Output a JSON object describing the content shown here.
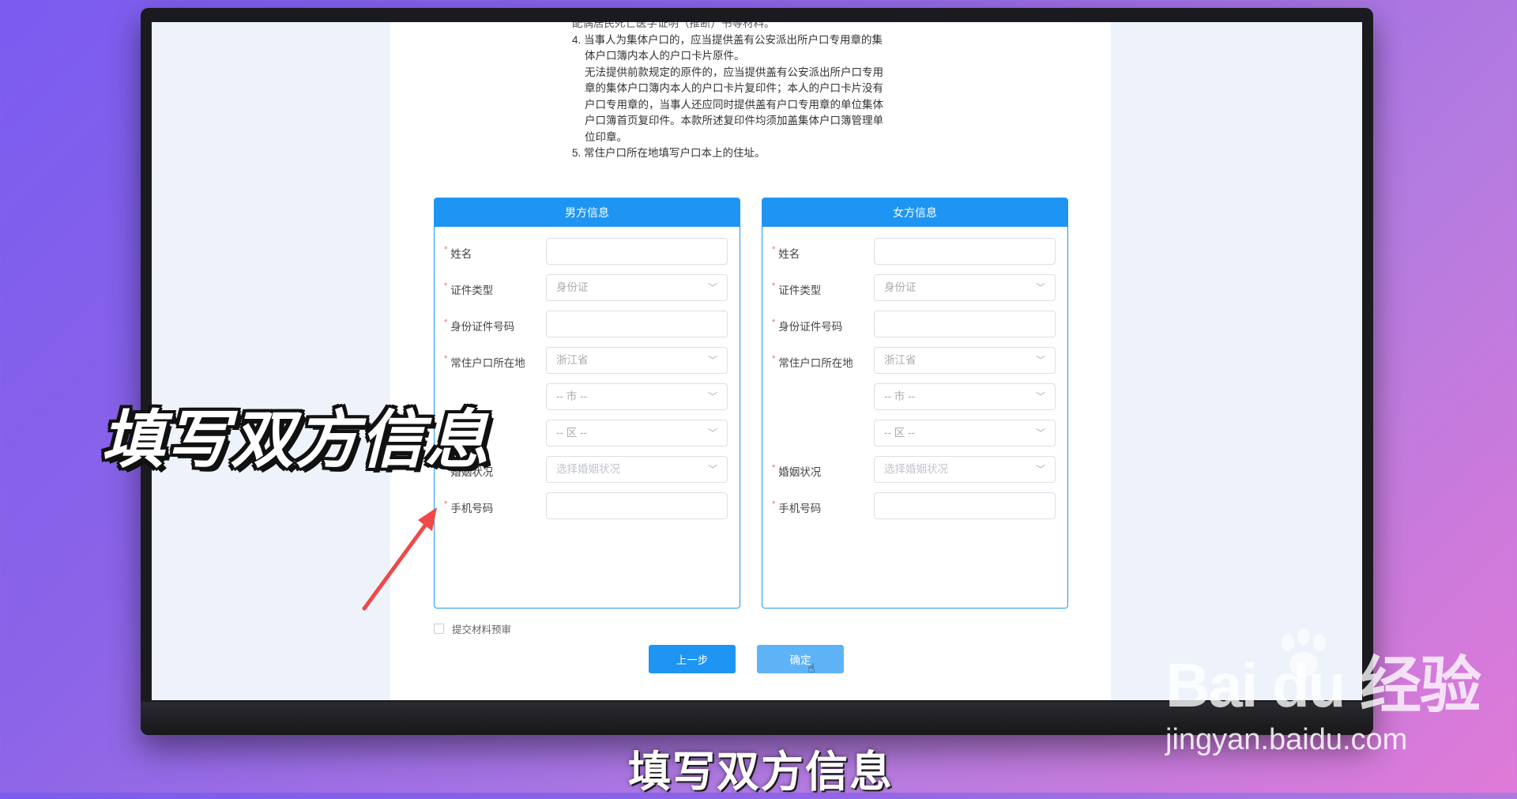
{
  "notes": {
    "line0": "配偶居民死亡医学证明（推断）书等材料。",
    "item4_a": "4. 当事人为集体户口的，应当提供盖有公安派出所户口专用章的集",
    "item4_b": "体户口簿内本人的户口卡片原件。",
    "item4_c": "无法提供前款规定的原件的，应当提供盖有公安派出所户口专用",
    "item4_d": "章的集体户口簿内本人的户口卡片复印件；本人的户口卡片没有",
    "item4_e": "户口专用章的，当事人还应同时提供盖有户口专用章的单位集体",
    "item4_f": "户口簿首页复印件。本款所述复印件均须加盖集体户口簿管理单",
    "item4_g": "位印章。",
    "item5": "5. 常住户口所在地填写户口本上的住址。"
  },
  "male": {
    "header": "男方信息",
    "name_label": "姓名",
    "idtype_label": "证件类型",
    "idtype_value": "身份证",
    "idno_label": "身份证件号码",
    "residence_label": "常住户口所在地",
    "province_value": "浙江省",
    "city_value": "-- 市 --",
    "district_value": "-- 区 --",
    "marital_label": "婚姻状况",
    "marital_placeholder": "选择婚姻状况",
    "phone_label": "手机号码"
  },
  "female": {
    "header": "女方信息",
    "name_label": "姓名",
    "idtype_label": "证件类型",
    "idtype_value": "身份证",
    "idno_label": "身份证件号码",
    "residence_label": "常住户口所在地",
    "province_value": "浙江省",
    "city_value": "-- 市 --",
    "district_value": "-- 区 --",
    "marital_label": "婚姻状况",
    "marital_placeholder": "选择婚姻状况",
    "phone_label": "手机号码"
  },
  "submit_check_label": "提交材料预审",
  "buttons": {
    "prev": "上一步",
    "ok": "确定"
  },
  "overlay_title": "填写双方信息",
  "subtitle": "填写双方信息",
  "watermark": {
    "logo": "Bai du 经验",
    "url": "jingyan.baidu.com"
  },
  "colors": {
    "primary": "#1e95f2",
    "required": "#f56c6c",
    "arrow": "#f04848"
  },
  "icons": {
    "chevron": "chevron-down-icon",
    "cursor": "hand-cursor-icon"
  }
}
